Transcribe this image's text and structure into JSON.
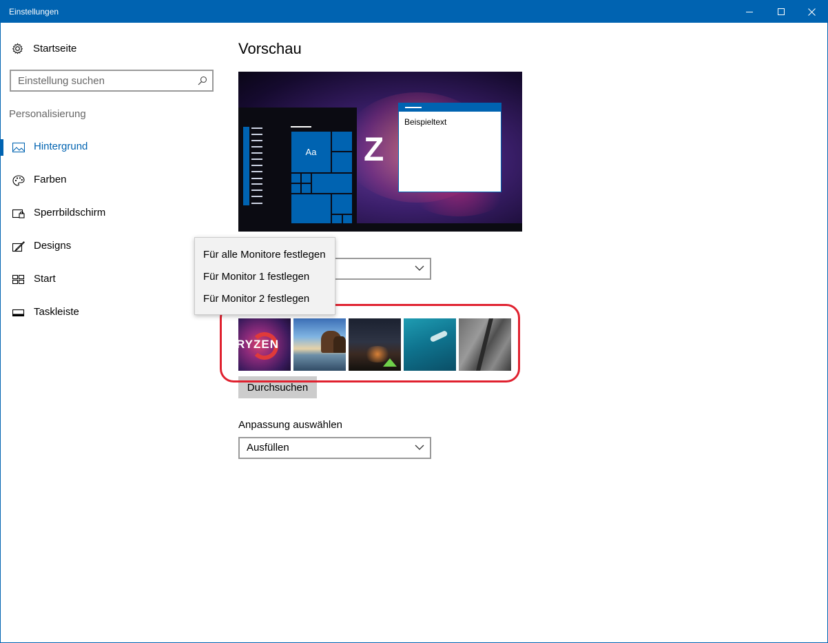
{
  "window": {
    "title": "Einstellungen",
    "controls": {
      "minimize": "minimize-icon",
      "maximize": "maximize-icon",
      "close": "close-icon"
    },
    "accent_color": "#0063b1"
  },
  "sidebar": {
    "home_label": "Startseite",
    "search_placeholder": "Einstellung suchen",
    "section_title": "Personalisierung",
    "items": [
      {
        "label": "Hintergrund",
        "icon": "picture-icon",
        "active": true
      },
      {
        "label": "Farben",
        "icon": "palette-icon",
        "active": false
      },
      {
        "label": "Sperrbildschirm",
        "icon": "lockscreen-icon",
        "active": false
      },
      {
        "label": "Designs",
        "icon": "brush-icon",
        "active": false
      },
      {
        "label": "Start",
        "icon": "start-tiles-icon",
        "active": false
      },
      {
        "label": "Taskleiste",
        "icon": "taskbar-icon",
        "active": false
      }
    ]
  },
  "main": {
    "heading": "Vorschau",
    "preview": {
      "tile_label": "Aa",
      "window_text": "Beispieltext",
      "wallpaper_text": "Z"
    },
    "context_menu": {
      "options": [
        "Für alle Monitore festlegen",
        "Für Monitor 1 festlegen",
        "Für Monitor 2 festlegen"
      ]
    },
    "thumbnails": [
      {
        "name": "ryzen-wallpaper",
        "text": "RYZEN"
      },
      {
        "name": "beach-rocks-wallpaper"
      },
      {
        "name": "night-sky-tent-wallpaper"
      },
      {
        "name": "underwater-diver-wallpaper"
      },
      {
        "name": "rock-cliff-wallpaper"
      }
    ],
    "browse_label": "Durchsuchen",
    "fit_label": "Anpassung auswählen",
    "fit_value": "Ausfüllen",
    "highlight_color": "#e0212f"
  }
}
